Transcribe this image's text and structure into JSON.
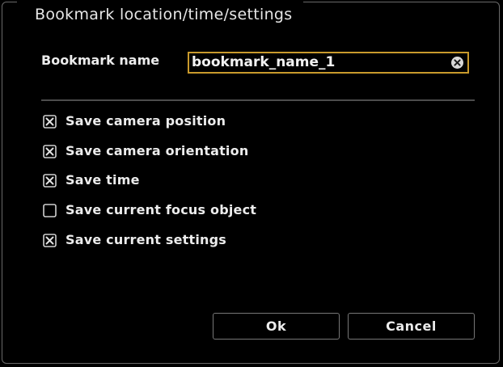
{
  "dialog": {
    "title": "Bookmark location/time/settings"
  },
  "bookmark_name": {
    "label": "Bookmark name",
    "value": "bookmark_name_1",
    "clear_icon": "clear-circle-x-icon"
  },
  "options": [
    {
      "label": "Save camera position",
      "checked": true
    },
    {
      "label": "Save camera orientation",
      "checked": true
    },
    {
      "label": "Save time",
      "checked": true
    },
    {
      "label": "Save current focus object",
      "checked": false
    },
    {
      "label": "Save current settings",
      "checked": true
    }
  ],
  "buttons": {
    "ok_label": "Ok",
    "cancel_label": "Cancel"
  },
  "colors": {
    "background": "#000000",
    "text": "#ececec",
    "focus_border": "#c99a2c",
    "border": "#6a6a6a"
  }
}
